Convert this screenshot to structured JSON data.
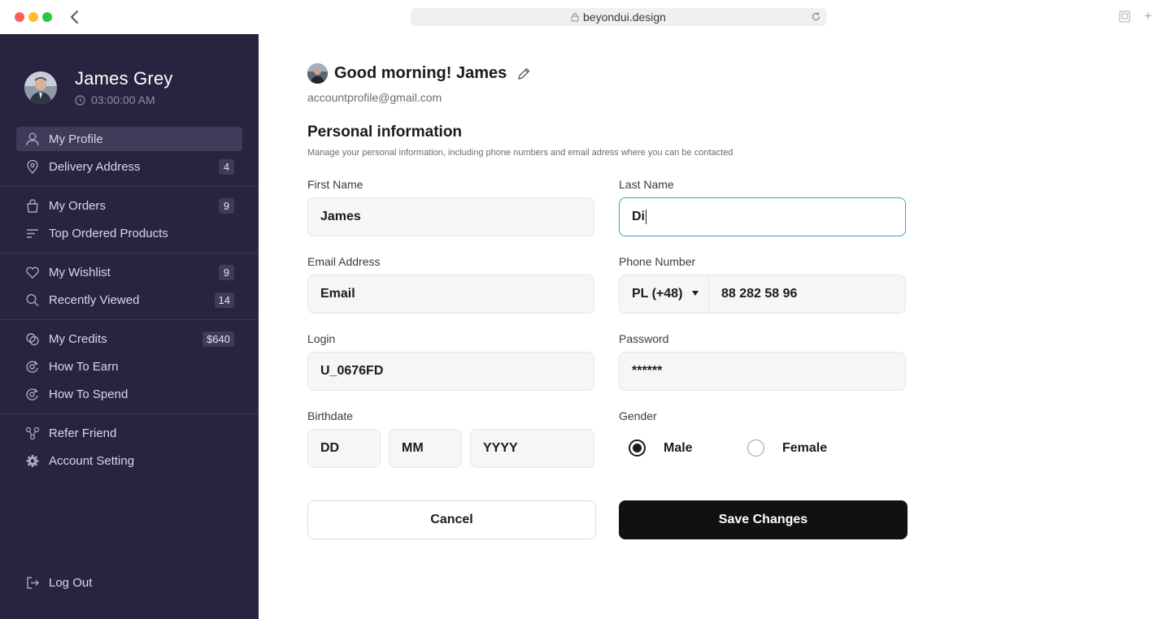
{
  "browser": {
    "url": "beyondui.design"
  },
  "sidebar": {
    "user_name": "James Grey",
    "time": "03:00:00 AM",
    "items": [
      {
        "label": "My Profile",
        "badge": ""
      },
      {
        "label": "Delivery Address",
        "badge": "4"
      },
      {
        "label": "My Orders",
        "badge": "9"
      },
      {
        "label": "Top Ordered Products",
        "badge": ""
      },
      {
        "label": "My Wishlist",
        "badge": "9"
      },
      {
        "label": "Recently Viewed",
        "badge": "14"
      },
      {
        "label": "My Credits",
        "badge": "$640"
      },
      {
        "label": "How To Earn",
        "badge": ""
      },
      {
        "label": "How To Spend",
        "badge": ""
      },
      {
        "label": "Refer Friend",
        "badge": ""
      },
      {
        "label": "Account Setting",
        "badge": ""
      }
    ],
    "logout": "Log Out"
  },
  "main": {
    "greeting": "Good morning! James",
    "email": "accountprofile@gmail.com",
    "section_title": "Personal information",
    "section_subtitle": "Manage your personal information, including phone numbers and email adress where you can be contacted",
    "form": {
      "first_name_label": "First Name",
      "first_name_value": "James",
      "last_name_label": "Last Name",
      "last_name_value": "Di",
      "email_label": "Email Address",
      "email_value": "Email",
      "phone_label": "Phone Number",
      "phone_country": "PL (+48)",
      "phone_value": "88 282 58 96",
      "login_label": "Login",
      "login_value": "U_0676FD",
      "password_label": "Password",
      "password_value": "******",
      "birthdate_label": "Birthdate",
      "birth_day": "DD",
      "birth_month": "MM",
      "birth_year": "YYYY",
      "gender_label": "Gender",
      "gender_male": "Male",
      "gender_female": "Female",
      "gender_selected": "Male"
    },
    "cancel_label": "Cancel",
    "save_label": "Save Changes"
  },
  "colors": {
    "sidebar_bg": "#28243f",
    "active_item_bg": "#3e3a57",
    "focus_border": "#3aa3c4",
    "primary_button": "#111111"
  }
}
